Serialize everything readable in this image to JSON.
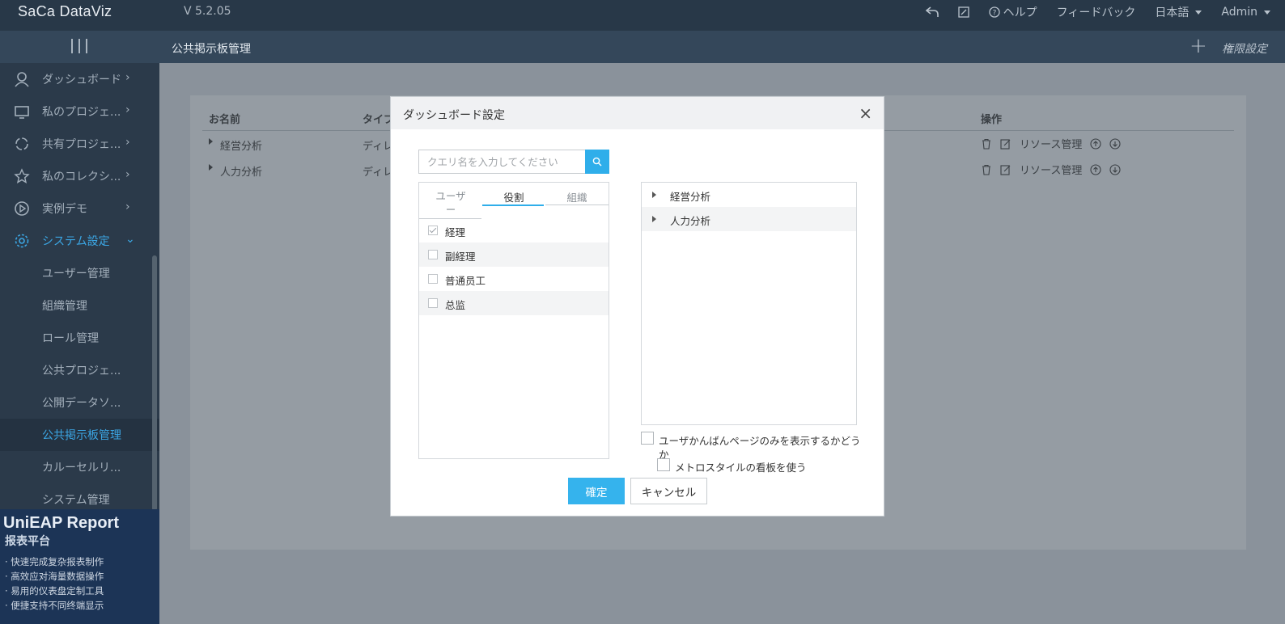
{
  "app": {
    "logo": "SaCa DataViz",
    "version": "V 5.2.05"
  },
  "topnav": {
    "help": "ヘルプ",
    "feedback": "フィードバック",
    "language": "日本語",
    "user": "Admin"
  },
  "subbar": {
    "title": "公共掲示板管理",
    "add_icon": "plus-icon",
    "permission": "権限設定"
  },
  "sidebar": {
    "items": [
      {
        "label": "ダッシュボード",
        "icon": "user-icon"
      },
      {
        "label": "私のプロジェ...",
        "icon": "monitor-icon"
      },
      {
        "label": "共有プロジェ...",
        "icon": "share-circle-icon"
      },
      {
        "label": "私のコレクシ...",
        "icon": "star-icon"
      },
      {
        "label": "実例デモ",
        "icon": "play-icon"
      },
      {
        "label": "システム設定",
        "icon": "gear-icon"
      }
    ],
    "subitems": [
      {
        "label": "ユーザー管理"
      },
      {
        "label": "組織管理"
      },
      {
        "label": "ロール管理"
      },
      {
        "label": "公共プロジェ..."
      },
      {
        "label": "公開データソ..."
      },
      {
        "label": "公共掲示板管理"
      },
      {
        "label": "カルーセルリ..."
      },
      {
        "label": "システム管理"
      }
    ]
  },
  "ad": {
    "title": "UniEAP Report",
    "subtitle": "报表平台",
    "lines": [
      "· 快速完成复杂报表制作",
      "· 高效应对海量数据操作",
      "· 易用的仪表盘定制工具",
      "· 便捷支持不同终端显示"
    ]
  },
  "table": {
    "columns": {
      "name": "お名前",
      "type": "タイプ",
      "ops": "操作"
    },
    "rows": [
      {
        "name": "経営分析",
        "type": "ディレ",
        "resource": "リソース管理"
      },
      {
        "name": "人力分析",
        "type": "ディレ",
        "resource": "リソース管理"
      }
    ]
  },
  "modal": {
    "title": "ダッシュボード設定",
    "close": "×",
    "search_placeholder": "クエリ名を入力してください",
    "tabs": {
      "user": "ユーザ",
      "user2": "ー",
      "role": "役割",
      "org": "組織"
    },
    "roles": [
      {
        "label": "経理",
        "checked": true
      },
      {
        "label": "副経理",
        "checked": false
      },
      {
        "label": "普通员工",
        "checked": false
      },
      {
        "label": "总监",
        "checked": false
      }
    ],
    "tree": [
      {
        "label": "経営分析"
      },
      {
        "label": "人力分析"
      }
    ],
    "option1_line1": "ユーザかんばんページのみを表示するかどう",
    "option1_line2": "か",
    "option2": "メトロスタイルの看板を使う",
    "ok": "確定",
    "cancel": "キャンセル"
  }
}
